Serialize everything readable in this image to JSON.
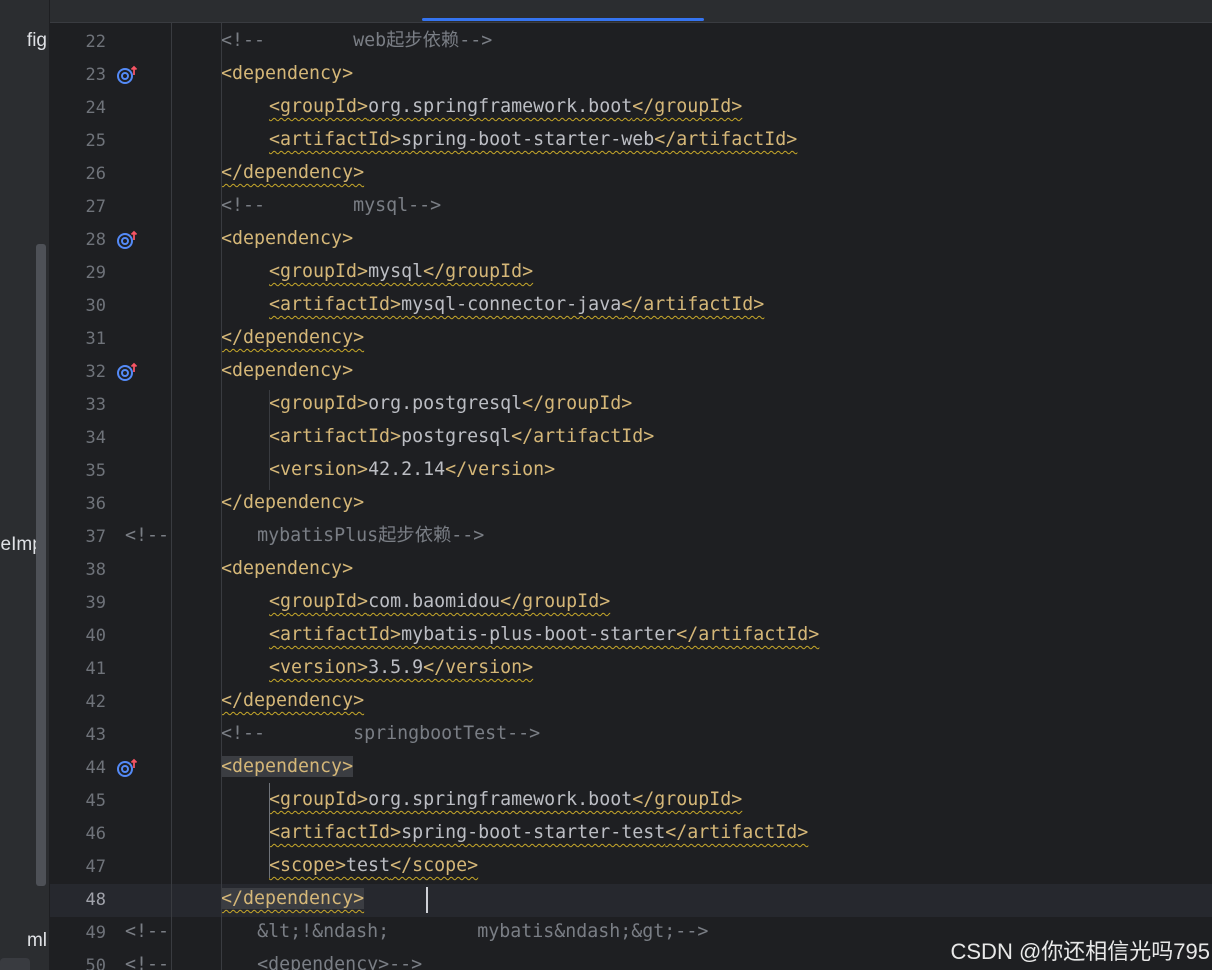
{
  "project_panel": {
    "items": [
      {
        "label": "fig"
      },
      {
        "label": "eImpl"
      },
      {
        "label": "ml"
      }
    ]
  },
  "editor": {
    "lines": [
      {
        "num": "22",
        "segments": [
          {
            "t": "cmt",
            "v": "<!--        web起步依赖-->"
          }
        ]
      },
      {
        "num": "23",
        "segments": [
          {
            "t": "tag",
            "v": "<dependency>"
          }
        ]
      },
      {
        "num": "24",
        "segments": [
          {
            "t": "tag",
            "v": "<groupId>"
          },
          {
            "t": "text",
            "v": "org.springframework.boot"
          },
          {
            "t": "tag",
            "v": "</groupId>"
          }
        ]
      },
      {
        "num": "25",
        "segments": [
          {
            "t": "tag",
            "v": "<artifactId>"
          },
          {
            "t": "text",
            "v": "spring-boot-starter-web"
          },
          {
            "t": "tag",
            "v": "</artifactId>"
          }
        ]
      },
      {
        "num": "26",
        "segments": [
          {
            "t": "tag",
            "v": "</dependency>"
          }
        ]
      },
      {
        "num": "27",
        "segments": [
          {
            "t": "cmt",
            "v": "<!--        mysql-->"
          }
        ]
      },
      {
        "num": "28",
        "segments": [
          {
            "t": "tag",
            "v": "<dependency>"
          }
        ]
      },
      {
        "num": "29",
        "segments": [
          {
            "t": "tag",
            "v": "<groupId>"
          },
          {
            "t": "text",
            "v": "mysql"
          },
          {
            "t": "tag",
            "v": "</groupId>"
          }
        ]
      },
      {
        "num": "30",
        "segments": [
          {
            "t": "tag",
            "v": "<artifactId>"
          },
          {
            "t": "text",
            "v": "mysql-connector-java"
          },
          {
            "t": "tag",
            "v": "</artifactId>"
          }
        ]
      },
      {
        "num": "31",
        "segments": [
          {
            "t": "tag",
            "v": "</dependency>"
          }
        ]
      },
      {
        "num": "32",
        "segments": [
          {
            "t": "tag",
            "v": "<dependency>"
          }
        ]
      },
      {
        "num": "33",
        "segments": [
          {
            "t": "tag",
            "v": "<groupId>"
          },
          {
            "t": "text",
            "v": "org.postgresql"
          },
          {
            "t": "tag",
            "v": "</groupId>"
          }
        ]
      },
      {
        "num": "34",
        "segments": [
          {
            "t": "tag",
            "v": "<artifactId>"
          },
          {
            "t": "text",
            "v": "postgresql"
          },
          {
            "t": "tag",
            "v": "</artifactId>"
          }
        ]
      },
      {
        "num": "35",
        "segments": [
          {
            "t": "tag",
            "v": "<version>"
          },
          {
            "t": "text",
            "v": "42.2.14"
          },
          {
            "t": "tag",
            "v": "</version>"
          }
        ]
      },
      {
        "num": "36",
        "segments": [
          {
            "t": "tag",
            "v": "</dependency>"
          }
        ]
      },
      {
        "num": "37",
        "segments": [
          {
            "t": "cmt",
            "v": "<!--        mybatisPlus起步依赖-->"
          }
        ]
      },
      {
        "num": "38",
        "segments": [
          {
            "t": "tag",
            "v": "<dependency>"
          }
        ]
      },
      {
        "num": "39",
        "segments": [
          {
            "t": "tag",
            "v": "<groupId>"
          },
          {
            "t": "text",
            "v": "com.baomidou"
          },
          {
            "t": "tag",
            "v": "</groupId>"
          }
        ]
      },
      {
        "num": "40",
        "segments": [
          {
            "t": "tag",
            "v": "<artifactId>"
          },
          {
            "t": "text",
            "v": "mybatis-plus-boot-starter"
          },
          {
            "t": "tag",
            "v": "</artifactId>"
          }
        ]
      },
      {
        "num": "41",
        "segments": [
          {
            "t": "tag",
            "v": "<version>"
          },
          {
            "t": "text",
            "v": "3.5.9"
          },
          {
            "t": "tag",
            "v": "</version>"
          }
        ]
      },
      {
        "num": "42",
        "segments": [
          {
            "t": "tag",
            "v": "</dependency>"
          }
        ]
      },
      {
        "num": "43",
        "segments": [
          {
            "t": "cmt",
            "v": "<!--        springbootTest-->"
          }
        ]
      },
      {
        "num": "44",
        "segments": [
          {
            "t": "tag",
            "v": "<dependency>",
            "hl": true
          }
        ]
      },
      {
        "num": "45",
        "segments": [
          {
            "t": "tag",
            "v": "<groupId>"
          },
          {
            "t": "text",
            "v": "org.springframework.boot"
          },
          {
            "t": "tag",
            "v": "</groupId>"
          }
        ]
      },
      {
        "num": "46",
        "segments": [
          {
            "t": "tag",
            "v": "<artifactId>"
          },
          {
            "t": "text",
            "v": "spring-boot-starter-test"
          },
          {
            "t": "tag",
            "v": "</artifactId>"
          }
        ]
      },
      {
        "num": "47",
        "segments": [
          {
            "t": "tag",
            "v": "<scope>"
          },
          {
            "t": "text",
            "v": "test"
          },
          {
            "t": "tag",
            "v": "</scope>"
          }
        ]
      },
      {
        "num": "48",
        "segments": [
          {
            "t": "tag",
            "v": "</dependency>",
            "hl": true
          }
        ]
      },
      {
        "num": "49",
        "segments": [
          {
            "t": "cmt",
            "v": "<!--        &lt;!&ndash;        mybatis&ndash;&gt;-->"
          }
        ]
      },
      {
        "num": "50",
        "segments": [
          {
            "t": "cmt",
            "v": "<!--        <dependency>-->"
          }
        ]
      }
    ]
  },
  "watermark": "CSDN @你还相信光吗795",
  "colors": {
    "background": "#1e1f22",
    "tag": "#d5b778",
    "comment": "#7a7e85",
    "text": "#bcbec4",
    "line_number": "#6f737a",
    "warning_underline": "#c7a82a",
    "gutter_icon": "#548af7",
    "gutter_arrow": "#f75464"
  }
}
